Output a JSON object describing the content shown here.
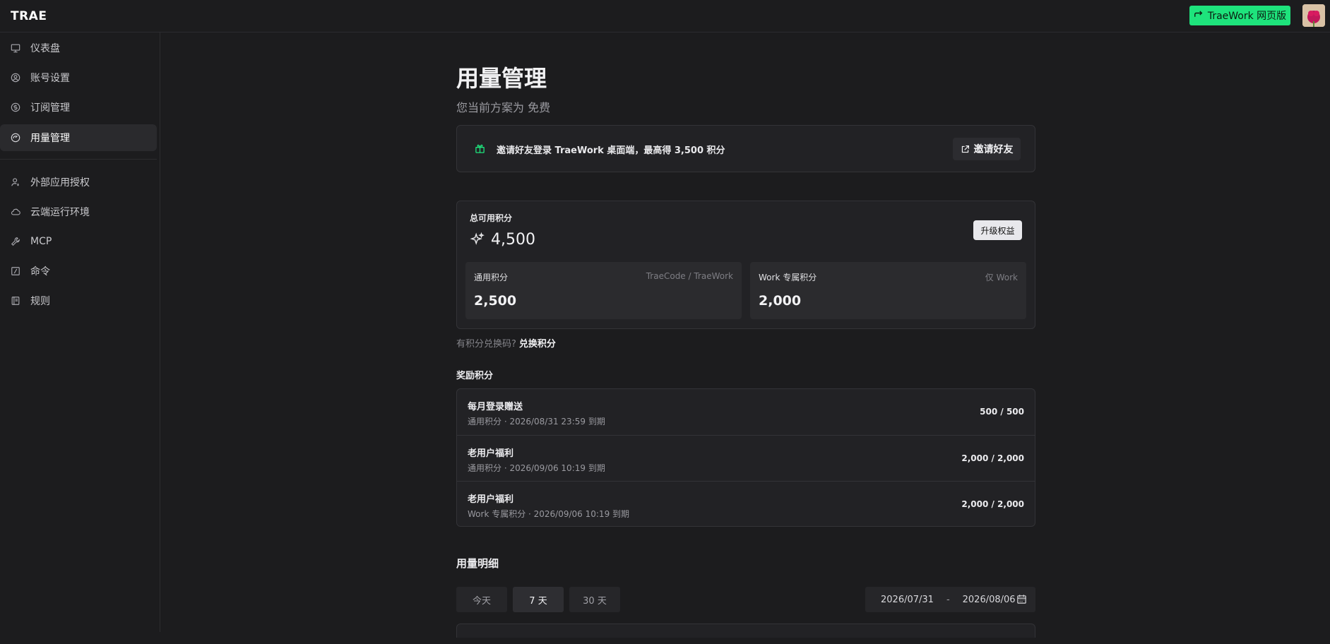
{
  "app": {
    "logo": "TRAE"
  },
  "header": {
    "web_button_label": "TraeWork 网页版"
  },
  "sidebar": {
    "items": [
      {
        "label": "仪表盘",
        "icon": "monitor-icon"
      },
      {
        "label": "账号设置",
        "icon": "user-circle-icon"
      },
      {
        "label": "订阅管理",
        "icon": "dollar-icon"
      },
      {
        "label": "用量管理",
        "icon": "gauge-icon",
        "active": true
      },
      {
        "label": "外部应用授权",
        "icon": "user-key-icon"
      },
      {
        "label": "云端运行环境",
        "icon": "cloud-icon"
      },
      {
        "label": "MCP",
        "icon": "wrench-icon"
      },
      {
        "label": "命令",
        "icon": "command-slash-icon"
      },
      {
        "label": "规则",
        "icon": "book-icon"
      }
    ]
  },
  "page": {
    "title": "用量管理",
    "plan_text": "您当前方案为 免费"
  },
  "invite": {
    "text": "邀请好友登录 TraeWork 桌面端，最高得 3,500 积分",
    "button_label": "邀请好友"
  },
  "points": {
    "total_label": "总可用积分",
    "total_value": "4,500",
    "upgrade_label": "升级权益",
    "general": {
      "label": "通用积分",
      "scope": "TraeCode / TraeWork",
      "value": "2,500"
    },
    "work": {
      "label": "Work 专属积分",
      "scope": "仅 Work",
      "value": "2,000"
    }
  },
  "redeem": {
    "question": "有积分兑换码?",
    "link": "兑换积分"
  },
  "rewards": {
    "title": "奖励积分",
    "rows": [
      {
        "name": "每月登录赠送",
        "meta": "通用积分 · 2026/08/31 23:59 到期",
        "amount": "500 / 500"
      },
      {
        "name": "老用户福利",
        "meta": "通用积分 · 2026/09/06 10:19 到期",
        "amount": "2,000 / 2,000"
      },
      {
        "name": "老用户福利",
        "meta": "Work 专属积分 · 2026/09/06 10:19 到期",
        "amount": "2,000 / 2,000"
      }
    ]
  },
  "usage": {
    "title": "用量明细",
    "ranges": [
      "今天",
      "7 天",
      "30 天"
    ],
    "active_range": "7 天",
    "date_start": "2026/07/31",
    "date_sep": "-",
    "date_end": "2026/08/06"
  },
  "colors": {
    "accent": "#1ee37c",
    "background": "#1c1c1e",
    "card": "#222225"
  }
}
